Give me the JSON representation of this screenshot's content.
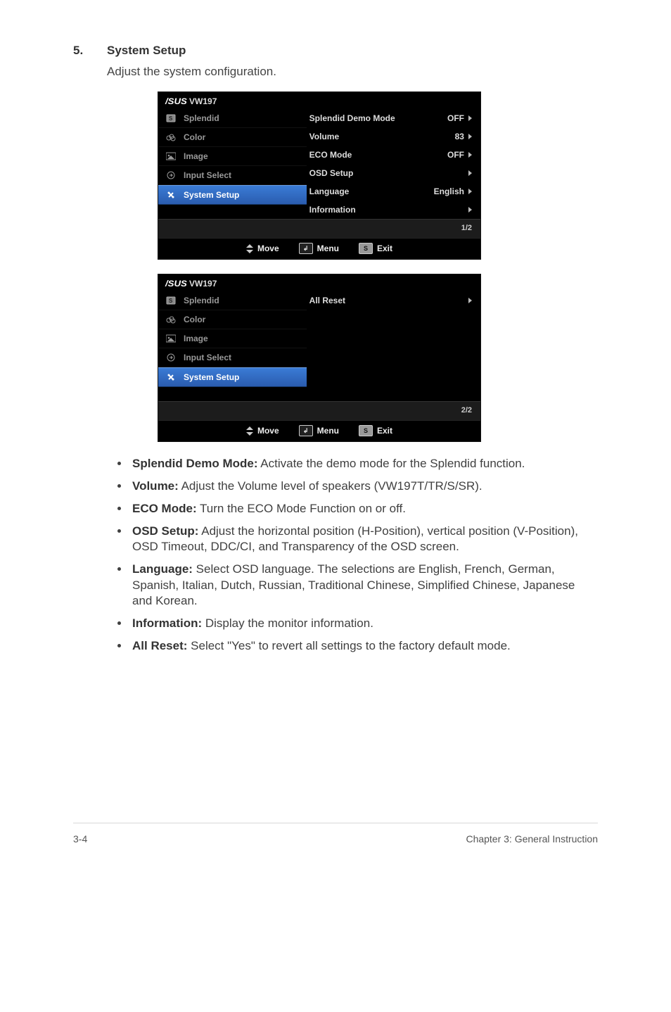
{
  "section": {
    "number": "5.",
    "title": "System Setup",
    "description": "Adjust the system configuration."
  },
  "logo_text": "/SUS",
  "osd1": {
    "model": "VW197",
    "menu": [
      {
        "label": "Splendid",
        "icon": "splendid"
      },
      {
        "label": "Color",
        "icon": "color"
      },
      {
        "label": "Image",
        "icon": "image"
      },
      {
        "label": "Input Select",
        "icon": "input"
      },
      {
        "label": "System Setup",
        "icon": "system",
        "selected": true
      }
    ],
    "options": [
      {
        "label": "Splendid Demo Mode",
        "value": "OFF"
      },
      {
        "label": "Volume",
        "value": "83"
      },
      {
        "label": "ECO Mode",
        "value": "OFF"
      },
      {
        "label": "OSD Setup",
        "value": ""
      },
      {
        "label": "Language",
        "value": "English"
      },
      {
        "label": "Information",
        "value": ""
      }
    ],
    "page_indicator": "1/2",
    "footer": {
      "move": "Move",
      "menu": "Menu",
      "exit": "Exit",
      "exit_key": "S"
    }
  },
  "osd2": {
    "model": "VW197",
    "menu": [
      {
        "label": "Splendid",
        "icon": "splendid"
      },
      {
        "label": "Color",
        "icon": "color"
      },
      {
        "label": "Image",
        "icon": "image"
      },
      {
        "label": "Input Select",
        "icon": "input"
      },
      {
        "label": "System Setup",
        "icon": "system",
        "selected": true
      }
    ],
    "options": [
      {
        "label": "All Reset",
        "value": ""
      }
    ],
    "page_indicator": "2/2",
    "footer": {
      "move": "Move",
      "menu": "Menu",
      "exit": "Exit",
      "exit_key": "S"
    }
  },
  "features": [
    {
      "name": "Splendid Demo Mode:",
      "desc": " Activate the demo mode for the Splendid function."
    },
    {
      "name": "Volume:",
      "desc": " Adjust the Volume level of speakers (VW197T/TR/S/SR)."
    },
    {
      "name": "ECO Mode:",
      "desc": " Turn the ECO Mode Function on or off."
    },
    {
      "name": "OSD Setup:",
      "desc": " Adjust the horizontal position (H-Position), vertical position (V-Position), OSD Timeout, DDC/CI, and Transparency of the OSD screen."
    },
    {
      "name": "Language:",
      "desc": " Select OSD language. The selections are English, French, German, Spanish, Italian, Dutch, Russian, Traditional Chinese, Simplified Chinese, Japanese and Korean."
    },
    {
      "name": "Information:",
      "desc": " Display the monitor information."
    },
    {
      "name": "All Reset:",
      "desc": " Select \"Yes\" to revert all settings to the factory default mode."
    }
  ],
  "footer": {
    "left": "3-4",
    "right": "Chapter 3: General Instruction"
  }
}
